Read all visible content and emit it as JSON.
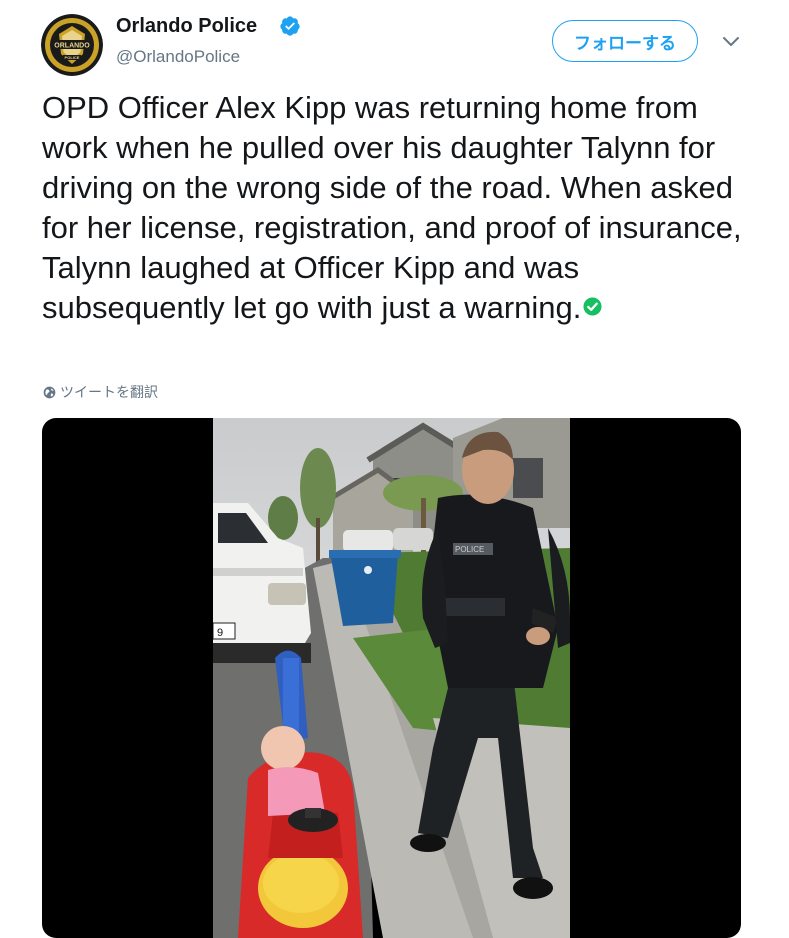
{
  "tweet": {
    "author_name": "Orlando Police",
    "handle": "@OrlandoPolice",
    "follow_label": "フォローする",
    "text": "OPD Officer Alex Kipp was returning home from work when he pulled over his daughter Talynn for driving on the wrong side of the road. When asked for her license, registration, and proof of insurance, Talynn laughed at Officer Kipp and was subsequently let go with just a warning.",
    "translate_label": "ツイートを翻訳",
    "badge": {
      "top": "ORLANDO",
      "bottom": "POLICE"
    }
  },
  "colors": {
    "accent": "#1da1f2",
    "text": "#14171a",
    "secondary": "#657786",
    "check_green": "#17bf63"
  },
  "icons": {
    "verified": "verified-badge-icon",
    "more": "chevron-down-icon",
    "globe": "globe-icon",
    "emoji": "white-check-mark-emoji"
  }
}
